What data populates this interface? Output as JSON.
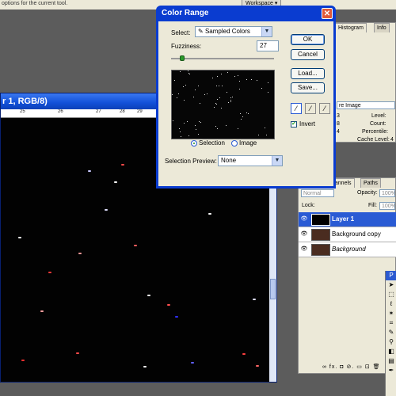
{
  "topbar": {
    "hint": "options for the current tool.",
    "workspace_label": "Workspace ▾"
  },
  "document": {
    "title_visible": "r 1, RGB/8)",
    "ruler_labels": [
      "25",
      "26",
      "27",
      "28",
      "29"
    ]
  },
  "color_range": {
    "title": "Color Range",
    "close_glyph": "✕",
    "select_label": "Select:",
    "select_value": "Sampled Colors",
    "fuzziness_label": "Fuzziness:",
    "fuzziness_value": "27",
    "fuzziness_level": 0.27,
    "selection_label": "Selection",
    "image_label": "Image",
    "preview_label": "Selection Preview:",
    "preview_value": "None",
    "ok_label": "OK",
    "cancel_label": "Cancel",
    "load_label": "Load...",
    "save_label": "Save...",
    "invert_label": "Invert",
    "invert_checked": true,
    "eyedroppers": [
      "eyedropper-icon",
      "eyedropper-plus-icon",
      "eyedropper-minus-icon"
    ]
  },
  "histogram_panel": {
    "tabs": [
      "Histogram",
      "Info"
    ],
    "source_value": "re Image",
    "labels": [
      "Level:",
      "Count:",
      "Percentile:",
      "Cache Level:"
    ],
    "cache_level_value": "4",
    "left_numbers": [
      "3",
      "8",
      "4"
    ]
  },
  "layers_panel": {
    "tabs": [
      "hannels",
      "Paths"
    ],
    "blend_mode": "Normal",
    "opacity_label": "Opacity:",
    "opacity_value": "100%",
    "lock_label": "Lock:",
    "fill_label": "Fill:",
    "fill_value": "100%",
    "layers": [
      {
        "name": "Layer 1",
        "selected": true
      },
      {
        "name": "Background copy",
        "selected": false
      },
      {
        "name": "Background",
        "selected": false
      }
    ],
    "footer_icons": "∞  fx.  ◘  ⊘.  ▭  ⊡  🗑"
  },
  "tools_palette": {
    "header": "P"
  },
  "colors": {
    "titlebar_blue": "#0a3cd0",
    "canvas_black": "#020202",
    "selected_layer": "#2a5bd4"
  }
}
